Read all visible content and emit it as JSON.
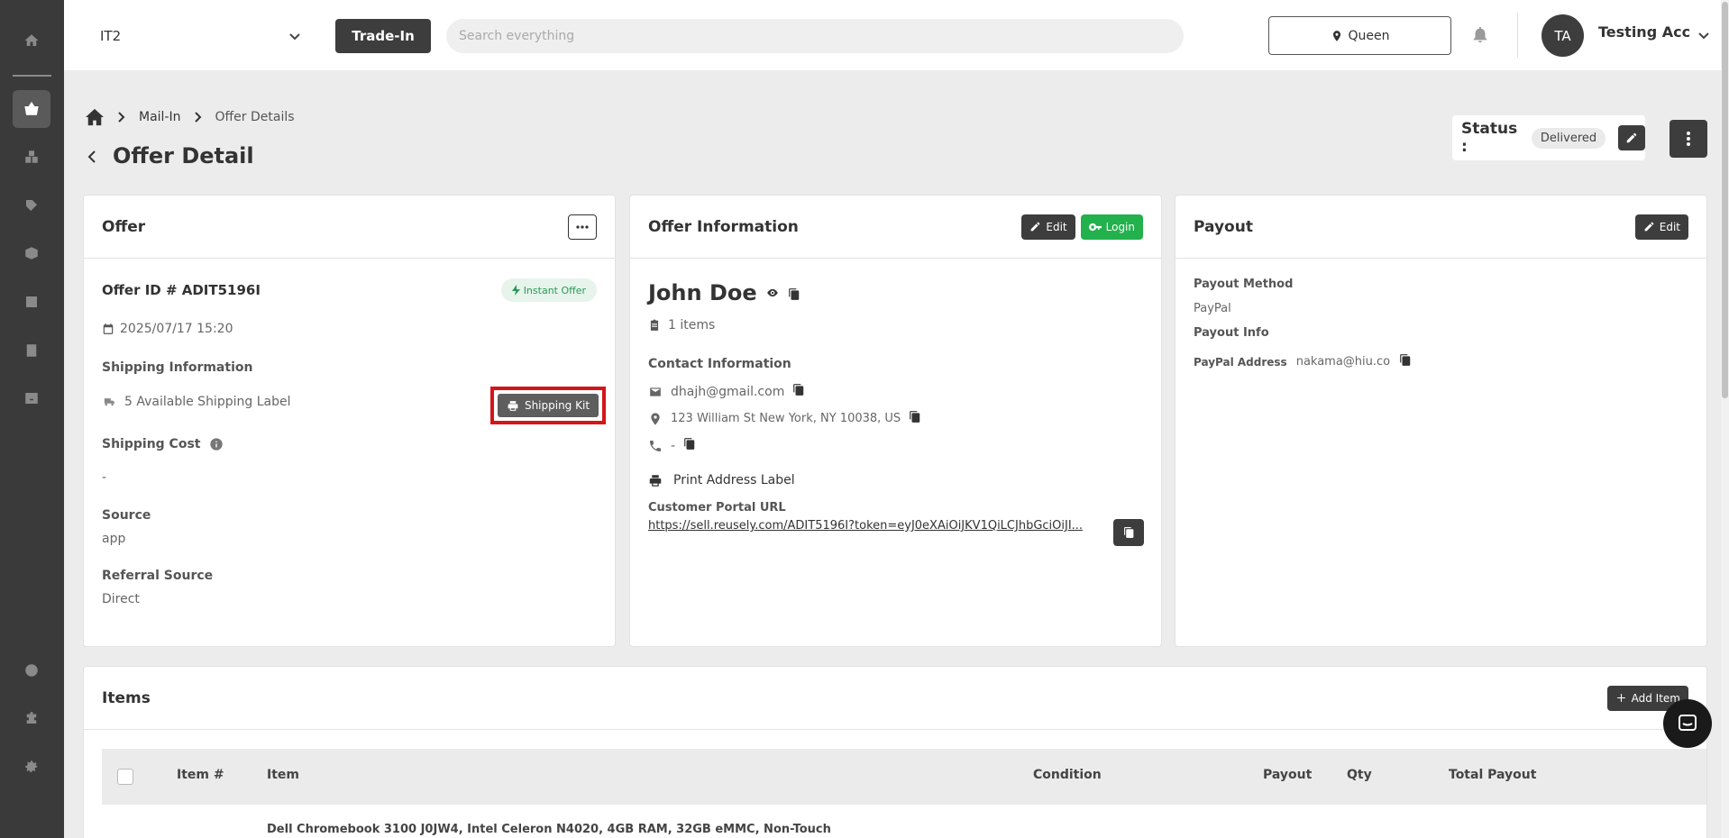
{
  "header": {
    "store": "IT2",
    "tradein_label": "Trade-In",
    "search_placeholder": "Search everything",
    "location": "Queen",
    "avatar_initials": "TA",
    "user_name": "Testing Acc"
  },
  "breadcrumb": [
    "Mail-In",
    "Offer Details"
  ],
  "page_title": "Offer Detail",
  "status": {
    "label": "Status :",
    "value": "Delivered"
  },
  "offer": {
    "title": "Offer",
    "id_line": "Offer ID # ADIT5196I",
    "badge": "Instant Offer",
    "date": "2025/07/17 15:20",
    "shipping_info_label": "Shipping Information",
    "shipping_labels": "5 Available Shipping Label",
    "shipping_kit_btn": "Shipping Kit",
    "shipping_cost_label": "Shipping Cost",
    "shipping_cost_value": "-",
    "source_label": "Source",
    "source_value": "app",
    "referral_label": "Referral Source",
    "referral_value": "Direct"
  },
  "offer_info": {
    "title": "Offer Information",
    "edit_btn": "Edit",
    "login_btn": "Login",
    "customer_name": "John Doe",
    "items_count": "1 items",
    "contact_label": "Contact Information",
    "email": "dhajh@gmail.com",
    "address": "123 William St New York, NY 10038, US",
    "phone": "-",
    "print_label": "Print Address Label",
    "portal_label": "Customer Portal URL",
    "portal_url": "https://sell.reusely.com/ADIT5196I?token=eyJ0eXAiOiJKV1QiLCJhbGciOiJI..."
  },
  "payout": {
    "title": "Payout",
    "edit_btn": "Edit",
    "method_label": "Payout Method",
    "method_value": "PayPal",
    "info_label": "Payout Info",
    "paypal_label": "PayPal Address",
    "paypal_value": "nakama@hiu.co"
  },
  "items": {
    "title": "Items",
    "add_btn": "Add Item",
    "columns": [
      "Item #",
      "Item",
      "Condition",
      "Payout",
      "Qty",
      "Total Payout"
    ],
    "rows": [
      {
        "item": "Dell Chromebook 3100 J0JW4, Intel Celeron N4020, 4GB RAM, 32GB eMMC, Non-Touch"
      }
    ]
  }
}
